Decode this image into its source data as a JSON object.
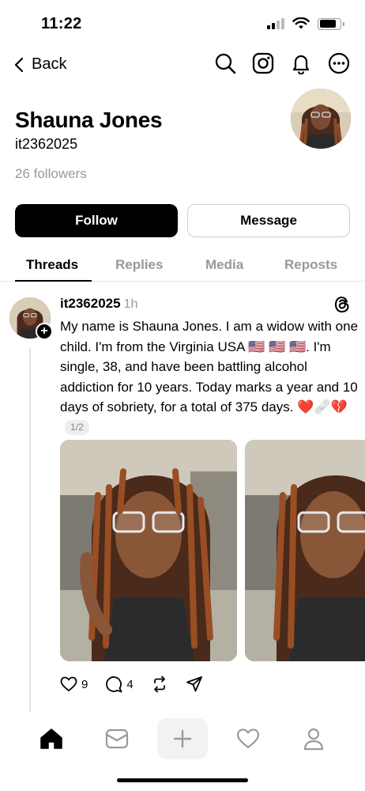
{
  "status": {
    "time": "11:22"
  },
  "nav": {
    "back_label": "Back",
    "icons": [
      "search-icon",
      "instagram-icon",
      "bell-icon",
      "more-icon"
    ]
  },
  "profile": {
    "name": "Shauna Jones",
    "handle": "it2362025",
    "followers": "26 followers",
    "follow_label": "Follow",
    "message_label": "Message"
  },
  "tabs": [
    {
      "label": "Threads",
      "active": true
    },
    {
      "label": "Replies",
      "active": false
    },
    {
      "label": "Media",
      "active": false
    },
    {
      "label": "Reposts",
      "active": false
    }
  ],
  "post": {
    "username": "it2362025",
    "time": "1h",
    "text": "My name is Shauna Jones. I am a widow with one child. I'm from the Virginia USA 🇺🇸  🇺🇸 🇺🇸. I'm single, 38, and have been battling alcohol addiction for 10 years. Today marks a year and 10 days of sobriety, for a total of 375 days. ❤️🩹💔",
    "page_indicator": "1/2",
    "likes": "9",
    "replies": "4"
  },
  "colors": {
    "primary": "#000000",
    "muted": "#999999",
    "divider": "#e6e6e6"
  }
}
